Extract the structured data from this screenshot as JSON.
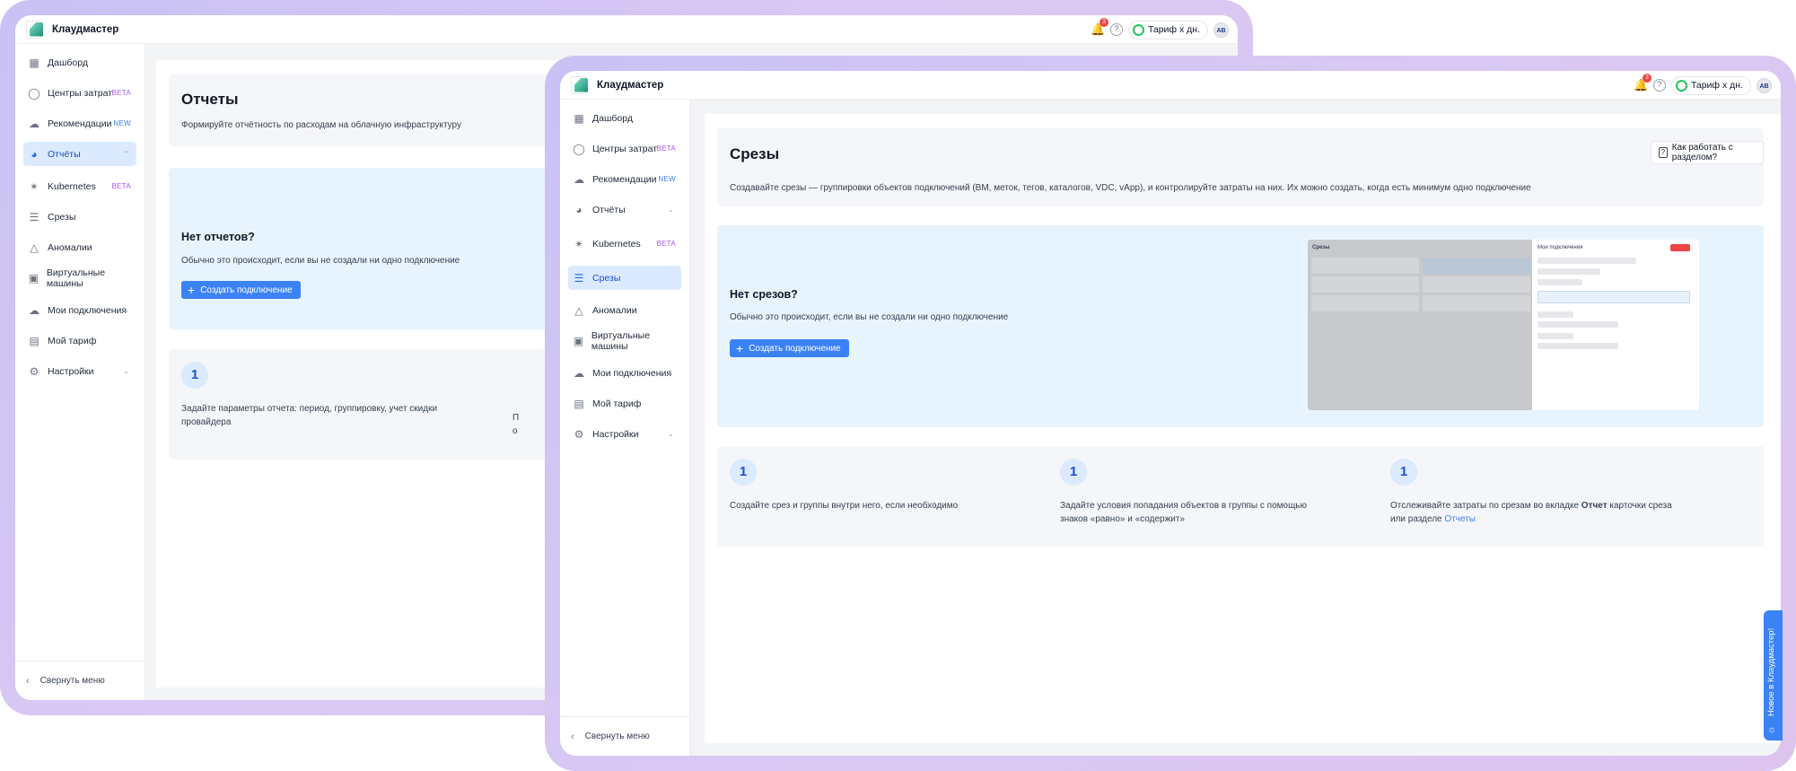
{
  "brand": {
    "name": "Клаудмастер"
  },
  "topbar": {
    "notifications_count": "3",
    "help_icon": "?",
    "plan_label": "Тариф х дн.",
    "avatar_initials": "AB"
  },
  "nav": {
    "dashboard": "Дашборд",
    "cost_centers": "Центры затрат",
    "recommendations": "Рекомендации",
    "reports": "Отчёты",
    "kubernetes": "Kubernetes",
    "slices": "Срезы",
    "anomalies": "Аномалии",
    "vms": "Виртуальные машины",
    "connections": "Мои подключения",
    "tariff": "Мой тариф",
    "settings": "Настройки",
    "beta": "BETA",
    "new": "NEW",
    "collapse": "Свернуть меню"
  },
  "back_window": {
    "title": "Отчеты",
    "subtitle": "Формируйте отчётность по расходам на облачную инфраструктуру",
    "empty_title": "Нет отчетов?",
    "empty_text": "Обычно это происходит, если вы не создали ни одно подключение",
    "create_button": "Создать подключение",
    "step1_num": "1",
    "step1_text": "Задайте параметры отчета: период, группировку, учет скидки провайдера",
    "step2_partial": "П",
    "step2_partial2": "о"
  },
  "front_window": {
    "title": "Срезы",
    "help_button": "Как работать с разделом?",
    "subtitle": "Создавайте срезы — группировки объектов подключений (ВМ, меток, тегов, каталогов, VDC, vApp), и контролируйте затраты на них. Их можно создать, когда есть минимум одно подключение",
    "empty_title": "Нет срезов?",
    "empty_text": "Обычно это происходит, если вы не создали ни одно подключение",
    "create_button": "Создать подключение",
    "steps": [
      {
        "num": "1",
        "text": "Создайте срез и группы внутри него, если необходимо"
      },
      {
        "num": "1",
        "text": "Задайте условия попадания объектов в группы с помощью знаков «равно» и «содержит»"
      },
      {
        "num": "1",
        "text_before": "Отслеживайте затраты по срезам во вкладке ",
        "text_bold": "Отчет",
        "text_mid": " карточки среза или разделе ",
        "text_link": "Отчеты"
      }
    ],
    "preview": {
      "title": "Срезы",
      "panel_title": "Мои подключения"
    }
  },
  "side_tab": {
    "label": "Новое в Клаудмастер!"
  },
  "colors": {
    "accent": "#3b82f6",
    "frame": "#d4c6f4",
    "active_bg": "#dbeafe",
    "beta": "#a855f7"
  }
}
